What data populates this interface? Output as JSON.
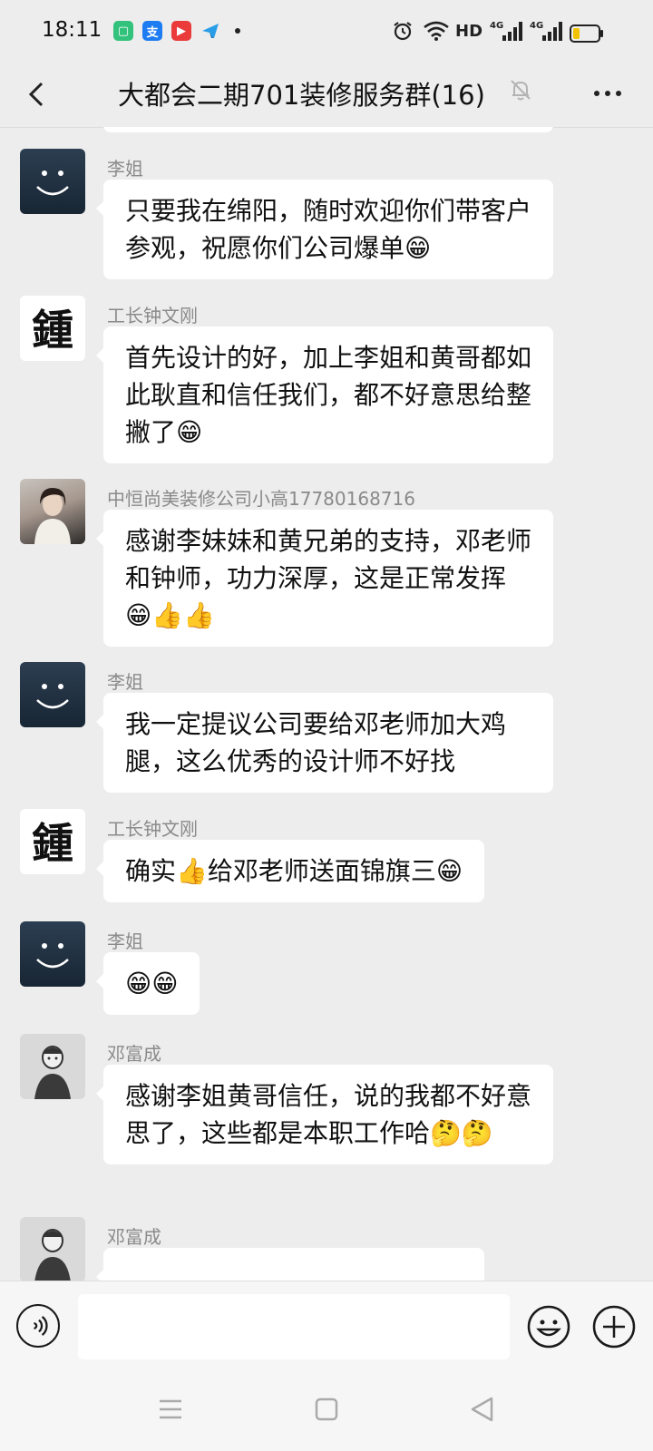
{
  "status_bar": {
    "time": "18:11",
    "network": [
      "HD",
      "4G",
      "4G"
    ],
    "battery_level": 0.25
  },
  "header": {
    "title": "大都会二期701装修服务群(16)",
    "mute_icon": "bell-slash-icon",
    "more_icon": "more-dots-icon"
  },
  "messages": [
    {
      "sender": "李姐",
      "text": "只要我在绵阳，随时欢迎你们带客户参观，祝愿你们公司爆单😁",
      "avatar": "smiley"
    },
    {
      "sender": "工长钟文刚",
      "text": "首先设计的好，加上李姐和黄哥都如此耿直和信任我们，都不好意思给整撇了😁",
      "avatar": "calligraphy"
    },
    {
      "sender": "中恒尚美装修公司小高17780168716",
      "text": "感谢李妹妹和黄兄弟的支持，邓老师和钟师，功力深厚，这是正常发挥😁👍👍",
      "avatar": "photo"
    },
    {
      "sender": "李姐",
      "text": "我一定提议公司要给邓老师加大鸡腿，这么优秀的设计师不好找",
      "avatar": "smiley"
    },
    {
      "sender": "工长钟文刚",
      "text": "确实👍给邓老师送面锦旗三😁",
      "avatar": "calligraphy"
    },
    {
      "sender": "李姐",
      "text": "😁😁",
      "avatar": "smiley"
    },
    {
      "sender": "邓富成",
      "text": "感谢李姐黄哥信任，说的我都不好意思了，这些都是本职工作哈🤔🤔",
      "avatar": "sketch"
    },
    {
      "sender": "邓富成",
      "text": "",
      "avatar": "sketch"
    }
  ],
  "input_bar": {
    "message_value": "",
    "voice_icon": "voice-icon",
    "emoji_icon": "emoji-icon",
    "plus_icon": "plus-icon"
  },
  "nav_bar": {
    "menu_icon": "menu-icon",
    "home_icon": "home-icon",
    "back_icon": "back-triangle-icon"
  },
  "colors": {
    "background": "#ededed",
    "bubble": "#ffffff",
    "sender_name": "#8a8a8a",
    "battery": "#f2c200"
  }
}
